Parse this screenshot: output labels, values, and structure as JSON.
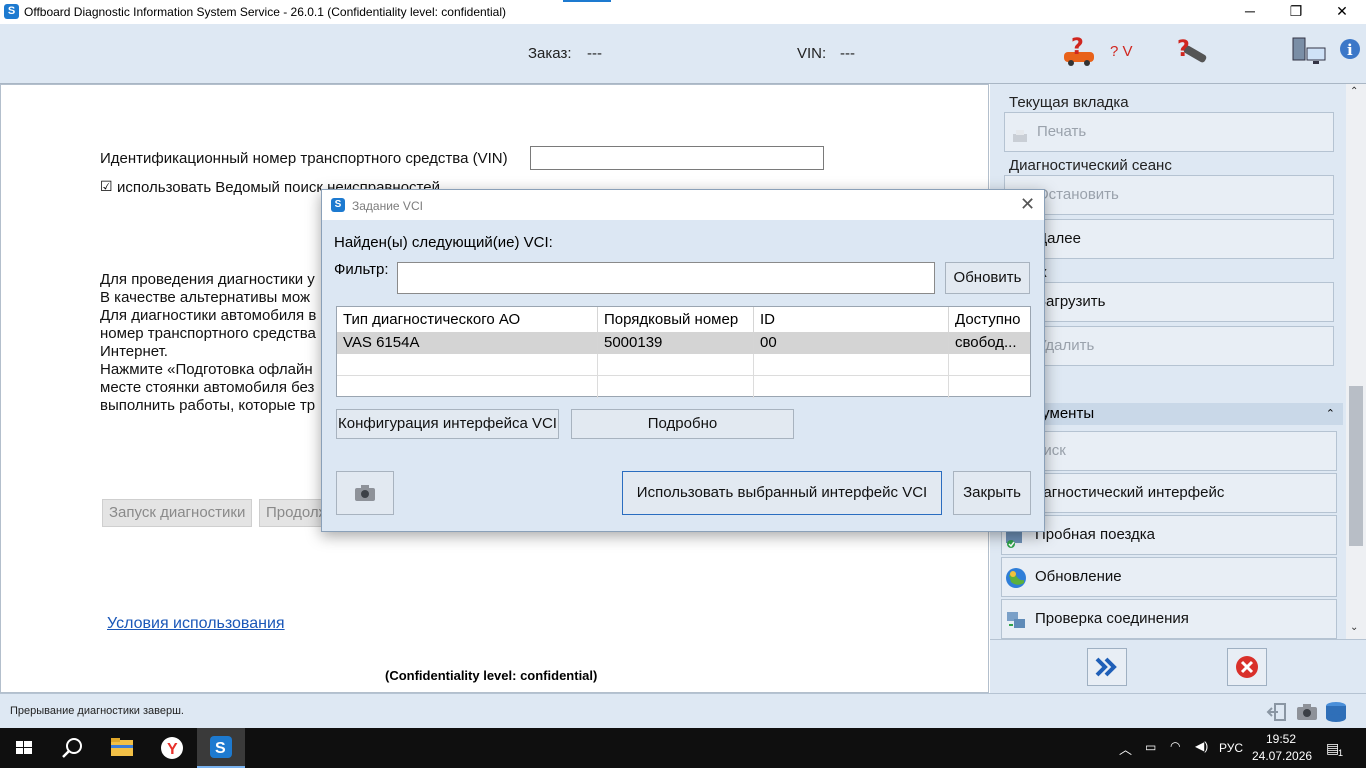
{
  "window": {
    "title": "Offboard Diagnostic Information System Service - 26.0.1 (Confidentiality level: confidential)",
    "logo_letter": "S",
    "minimize_symbol": "─",
    "maximize_symbol": "❐",
    "close_symbol": "✕"
  },
  "header": {
    "order_label": "Заказ:",
    "order_value": "---",
    "vin_label": "VIN:",
    "vin_value": "---",
    "help_vehicle_text": "? V",
    "icons": [
      "help-vehicle-icon",
      "help-tool-icon",
      "network-icon",
      "info-icon"
    ]
  },
  "main": {
    "vin_field_label": "Идентификационный номер транспортного средства (VIN)",
    "vin_field_value": "",
    "guided_search_label": "использовать Ведомый поиск неисправностей",
    "guided_search_checked": true,
    "info_lines": [
      "Для проведения диагностики у",
      "В качестве альтернативы мож",
      "Для диагностики автомобиля в",
      "номер транспортного средства",
      "Интернет.",
      "Нажмите «Подготовка офлайн",
      "месте стоянки автомобиля без",
      "выполнить работы, которые тр"
    ],
    "start_diagnostics_button": "Запуск диагностики",
    "continue_button": "Продолж",
    "terms_link": "Условия использования",
    "confidentiality_footer": "(Confidentiality level: confidential)"
  },
  "right_panel": {
    "current_tab_section": "Текущая вкладка",
    "print_button": "Печать",
    "session_section": "Диагностический сеанс",
    "stop_button": "Остановить",
    "next_button": "Далее",
    "load_button": "Загрузить",
    "delete_button": "Удалить",
    "partial_k": "к",
    "tools_header": "рументы",
    "search_button": "оиск",
    "diag_interface_button": "иагностический интерфейс",
    "test_drive_button": "Пробная поездка",
    "update_button": "Обновление",
    "connection_check_button": "Проверка соединения",
    "forward_icon": "double-chevron-right-icon",
    "cancel_icon": "red-x-icon"
  },
  "statusbar": {
    "text": "Прерывание диагностики заверш."
  },
  "dialog": {
    "title": "Задание VCI",
    "close_symbol": "✕",
    "found_label": "Найден(ы) следующий(ие) VCI:",
    "filter_label": "Фильтр:",
    "filter_value": "",
    "refresh_button": "Обновить",
    "columns": [
      "Тип диагностического АО",
      "Порядковый номер",
      "ID",
      "Доступно"
    ],
    "rows": [
      [
        "VAS 6154A",
        "5000139",
        "00",
        "свобод..."
      ]
    ],
    "config_button": "Конфигурация интерфейса VCI",
    "details_button": "Подробно",
    "use_selected_button": "Использовать выбранный интерфейс VCI",
    "close_button": "Закрыть",
    "camera_icon": "camera-icon"
  },
  "taskbar": {
    "items": [
      "windows-start-icon",
      "search-icon",
      "file-explorer-icon",
      "yandex-browser-icon",
      "odis-app-icon"
    ],
    "language": "РУС",
    "time": "19:52",
    "date": "24.07.2026",
    "notification_count": "1"
  },
  "colors": {
    "panel_bg": "#dee8f3",
    "accent_blue": "#1d7ad0",
    "link": "#1a57b8",
    "help_red": "#d0261f"
  }
}
